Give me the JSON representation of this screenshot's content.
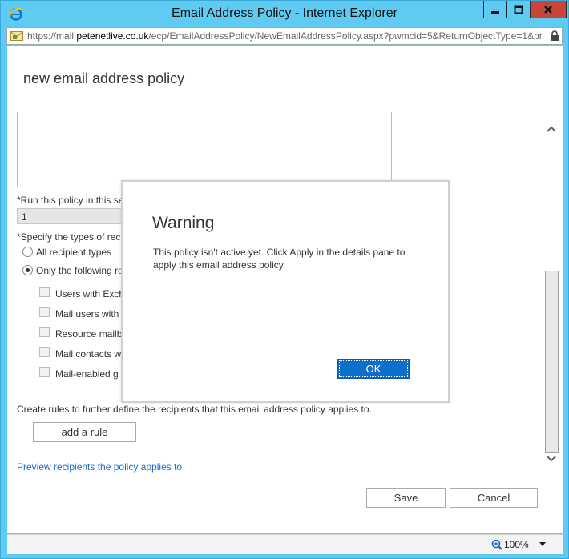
{
  "window": {
    "title": "Email Address Policy - Internet Explorer",
    "minimize_icon": "minimize-icon",
    "maximize_icon": "maximize-icon",
    "close_icon": "close-icon"
  },
  "address_bar": {
    "prefix": "https://mail.",
    "domain": "petenetlive.co.uk",
    "path": "/ecp/EmailAddressPolicy/NewEmailAddressPolicy.aspx?pwmcid=5&ReturnObjectType=1&pr"
  },
  "page": {
    "title": "new email address policy",
    "priority_label": "*Run this policy in this se",
    "priority_value": "1",
    "recipient_types_label": "*Specify the types of rec",
    "radio_all": "All recipient types",
    "radio_only": "Only the following re",
    "checkboxes": [
      "Users with Exch",
      "Mail users with",
      "Resource mailb",
      "Mail contacts w",
      "Mail-enabled g"
    ],
    "rules_text": "Create rules to further define the recipients that this email address policy applies to.",
    "add_rule_label": "add a rule",
    "preview_link": "Preview recipients the policy applies to",
    "save_label": "Save",
    "cancel_label": "Cancel"
  },
  "dialog": {
    "title": "Warning",
    "message": "This policy isn't active yet. Click Apply in the details pane to apply this email address policy.",
    "ok_label": "OK"
  },
  "status_bar": {
    "zoom": "100%"
  },
  "colors": {
    "frame": "#5fcbf2",
    "close": "#c7453a",
    "ok_button": "#0e6fcb",
    "link": "#1e6ec2"
  }
}
